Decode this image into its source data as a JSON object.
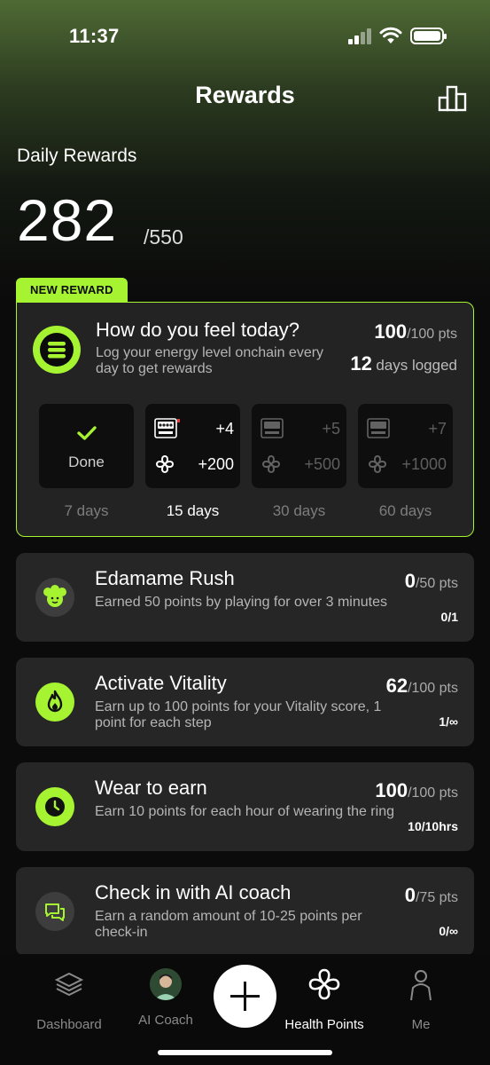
{
  "status_bar": {
    "time": "11:37"
  },
  "header": {
    "title": "Rewards",
    "chart_icon": "bar-chart-icon"
  },
  "daily": {
    "label": "Daily Rewards",
    "value": "282",
    "total": "/550"
  },
  "feature": {
    "badge": "NEW REWARD",
    "icon": "layers-icon",
    "title": "How do you feel today?",
    "description": "Log your energy level onchain every day to get rewards",
    "points": "100",
    "points_total": "/100 pts",
    "days_logged": "12",
    "days_logged_label": "days logged",
    "tiers": [
      {
        "done_label": "Done",
        "label": "7 days",
        "status": "done"
      },
      {
        "chip_value": "+4",
        "points_value": "+200",
        "label": "15 days",
        "status": "active"
      },
      {
        "chip_value": "+5",
        "points_value": "+500",
        "label": "30 days",
        "status": "locked"
      },
      {
        "chip_value": "+7",
        "points_value": "+1000",
        "label": "60 days",
        "status": "locked"
      }
    ]
  },
  "tasks": [
    {
      "title": "Edamame Rush",
      "description": "Earned 50 points by playing for over 3 minutes",
      "points": "0",
      "points_total": "/50 pts",
      "progress": "0/1",
      "icon": "edamame-icon"
    },
    {
      "title": "Activate Vitality",
      "description": "Earn up to 100 points for your Vitality score, 1 point for each step",
      "points": "62",
      "points_total": "/100 pts",
      "progress": "1/∞",
      "icon": "flame-icon"
    },
    {
      "title": "Wear to earn",
      "description": "Earn 10 points for each hour of wearing the ring",
      "points": "100",
      "points_total": "/100 pts",
      "progress": "10/10hrs",
      "icon": "clock-icon"
    },
    {
      "title": "Check in with AI coach",
      "description": "Earn a random amount of 10-25 points per check-in",
      "points": "0",
      "points_total": "/75 pts",
      "progress": "0/∞",
      "icon": "chat-icon"
    }
  ],
  "tab_bar": {
    "tabs": [
      {
        "label": "Dashboard",
        "icon": "stack-icon"
      },
      {
        "label": "AI Coach",
        "icon": "avatar"
      },
      {
        "label": "Health Points",
        "icon": "health-points-icon",
        "active": true
      },
      {
        "label": "Me",
        "icon": "person-icon"
      }
    ],
    "add_button": "plus-icon"
  },
  "colors": {
    "accent": "#a6f431",
    "card": "#262626",
    "background": "#0b0b0b"
  }
}
